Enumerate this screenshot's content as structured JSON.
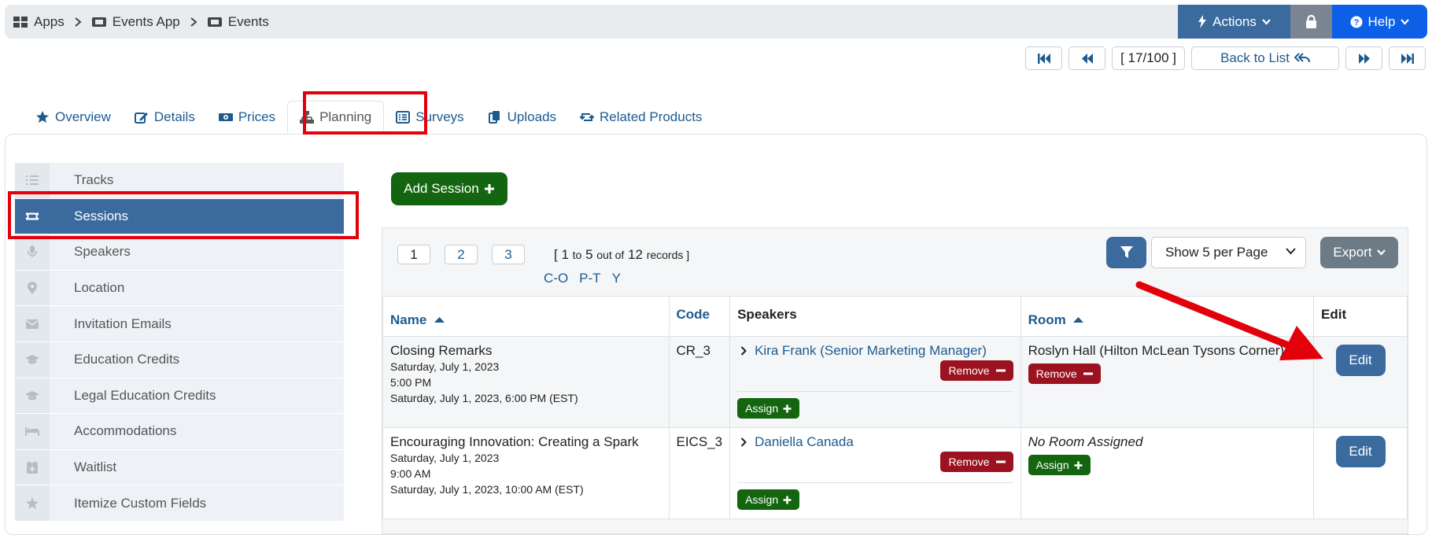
{
  "breadcrumb": [
    {
      "label": "Apps",
      "icon": "grid-icon"
    },
    {
      "label": "Events App",
      "icon": "ticket-icon"
    },
    {
      "label": "Events",
      "icon": "ticket-icon"
    }
  ],
  "topbar": {
    "actions_label": "Actions",
    "help_label": "Help"
  },
  "pager": {
    "count": "[ 17/100 ]",
    "back_label": "Back to List"
  },
  "tabs": [
    {
      "label": "Overview",
      "icon": "star-icon"
    },
    {
      "label": "Details",
      "icon": "edit-icon"
    },
    {
      "label": "Prices",
      "icon": "money-icon"
    },
    {
      "label": "Planning",
      "icon": "sitemap-icon",
      "active": true
    },
    {
      "label": "Surveys",
      "icon": "list-icon"
    },
    {
      "label": "Uploads",
      "icon": "copy-icon"
    },
    {
      "label": "Related Products",
      "icon": "retweet-icon"
    }
  ],
  "sidebar": {
    "items": [
      {
        "label": "Tracks",
        "icon": "list-icon"
      },
      {
        "label": "Sessions",
        "icon": "ticket-icon",
        "active": true
      },
      {
        "label": "Speakers",
        "icon": "microphone-icon"
      },
      {
        "label": "Location",
        "icon": "map-marker-icon"
      },
      {
        "label": "Invitation Emails",
        "icon": "envelope-icon"
      },
      {
        "label": "Education Credits",
        "icon": "graduation-cap-icon"
      },
      {
        "label": "Legal Education Credits",
        "icon": "graduation-cap-icon"
      },
      {
        "label": "Accommodations",
        "icon": "bed-icon"
      },
      {
        "label": "Waitlist",
        "icon": "calendar-plus-icon"
      },
      {
        "label": "Itemize Custom Fields",
        "icon": "star-icon"
      }
    ]
  },
  "main": {
    "add_session_label": "Add Session",
    "pages": [
      "1",
      "2",
      "3"
    ],
    "records": {
      "open": "[ 1",
      "to": "to",
      "five": "5",
      "out_of": "out of",
      "total": "12",
      "records_word": "records ]"
    },
    "alpha_filters": [
      "C-O",
      "P-T",
      "Y"
    ],
    "per_page": "Show 5 per Page",
    "export_label": "Export",
    "columns": {
      "name": "Name",
      "code": "Code",
      "speakers": "Speakers",
      "room": "Room",
      "edit": "Edit"
    },
    "rows": [
      {
        "name": "Closing Remarks",
        "date": "Saturday, July 1, 2023",
        "time": "5:00 PM",
        "end": "Saturday, July 1, 2023, 6:00 PM (EST)",
        "code": "CR_3",
        "speaker": "Kira Frank (Senior Marketing Manager)",
        "room": "Roslyn Hall (Hilton McLean Tysons Corner)",
        "room_action": "Remove",
        "speaker_remove": "Remove",
        "assign": "Assign",
        "edit": "Edit"
      },
      {
        "name": "Encouraging Innovation: Creating a Spark",
        "date": "Saturday, July 1, 2023",
        "time": "9:00 AM",
        "end": "Saturday, July 1, 2023, 10:00 AM (EST)",
        "code": "EICS_3",
        "speaker": "Daniella Canada",
        "room": "No Room Assigned",
        "room_action": "Assign",
        "speaker_remove": "Remove",
        "assign": "Assign",
        "edit": "Edit"
      }
    ]
  },
  "colors": {
    "primary": "#3b6a9e",
    "success": "#13660f",
    "danger": "#9b1320",
    "help": "#0d5fe8",
    "annotation": "#e3000b",
    "link": "#1d5b8f"
  }
}
